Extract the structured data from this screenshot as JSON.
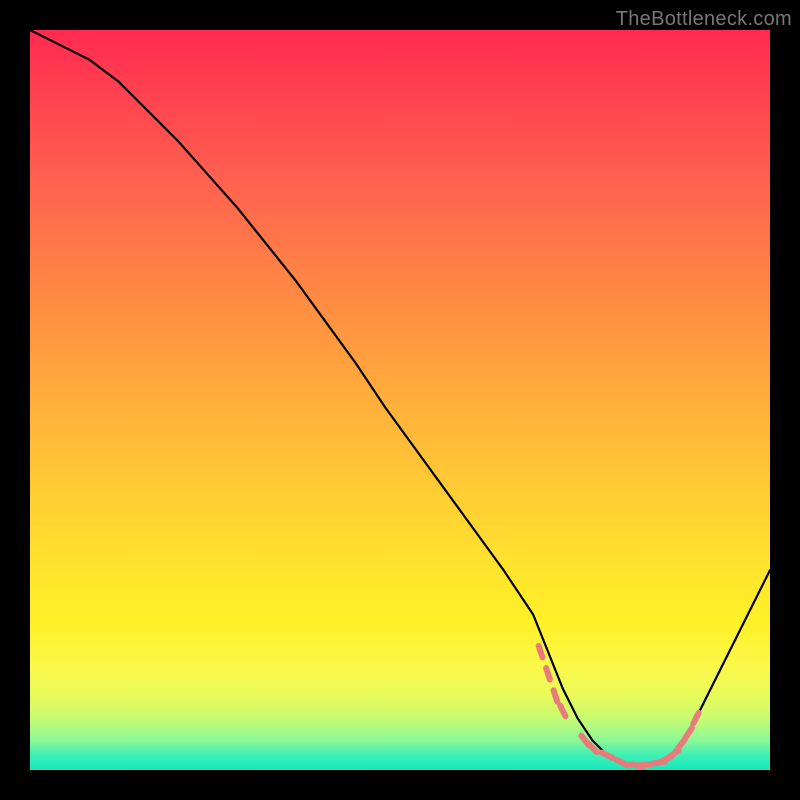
{
  "watermark": "TheBottleneck.com",
  "chart_data": {
    "type": "line",
    "title": "",
    "xlabel": "",
    "ylabel": "",
    "xlim": [
      0,
      100
    ],
    "ylim": [
      0,
      100
    ],
    "series": [
      {
        "name": "bottleneck-curve",
        "x": [
          0,
          4,
          8,
          12,
          16,
          20,
          24,
          28,
          32,
          36,
          40,
          44,
          48,
          52,
          56,
          60,
          64,
          68,
          70,
          72,
          74,
          76,
          78,
          80,
          82,
          84,
          86,
          88,
          90,
          92,
          94,
          96,
          98,
          100
        ],
        "values": [
          100,
          98,
          96,
          93,
          89,
          85,
          80.5,
          76,
          71,
          66,
          60.5,
          55,
          49,
          43.5,
          38,
          32.5,
          27,
          21,
          16,
          11,
          7,
          4,
          2,
          1,
          0.5,
          0.7,
          1.5,
          3.5,
          7,
          11,
          15,
          19,
          23,
          27
        ]
      }
    ],
    "markers": {
      "name": "optimal-band",
      "color": "#e77c7a",
      "x": [
        69,
        70,
        71,
        72,
        75,
        76,
        78,
        80,
        82,
        83,
        85,
        86,
        87,
        88,
        89,
        90
      ],
      "values": [
        16,
        13,
        10,
        8,
        4,
        3,
        2,
        1,
        0.6,
        0.7,
        1.0,
        1.5,
        2.2,
        3.5,
        5,
        7
      ]
    },
    "gradient_background": {
      "top_color": "#ff2a4f",
      "bottom_color": "#14e8c0",
      "meaning": "red=high-bottleneck, green=optimal"
    }
  }
}
